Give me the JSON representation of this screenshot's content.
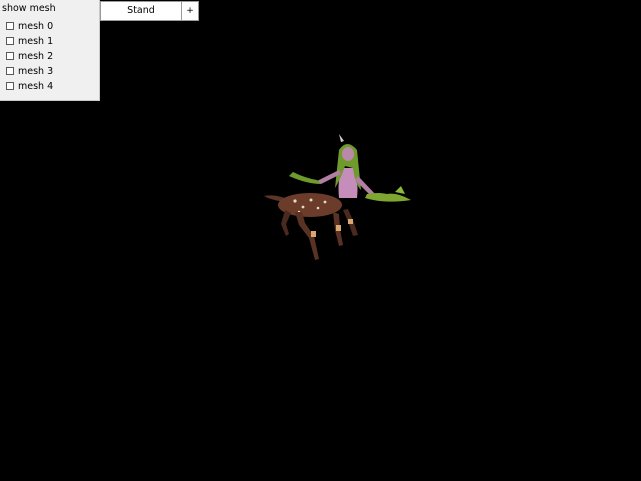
{
  "mesh_panel": {
    "title": "show mesh",
    "items": [
      {
        "label": "mesh 0",
        "checked": false
      },
      {
        "label": "mesh 1",
        "checked": false
      },
      {
        "label": "mesh 2",
        "checked": false
      },
      {
        "label": "mesh 3",
        "checked": false
      },
      {
        "label": "mesh 4",
        "checked": false
      }
    ]
  },
  "animation": {
    "selected": "Stand",
    "button_label": "+"
  },
  "viewport": {
    "background": "#000000"
  },
  "colors": {
    "panel_bg": "#f0f0f0",
    "model_skin": "#c58dba",
    "model_fur": "#6b3c2a",
    "model_foliage": "#6f9a2c"
  }
}
